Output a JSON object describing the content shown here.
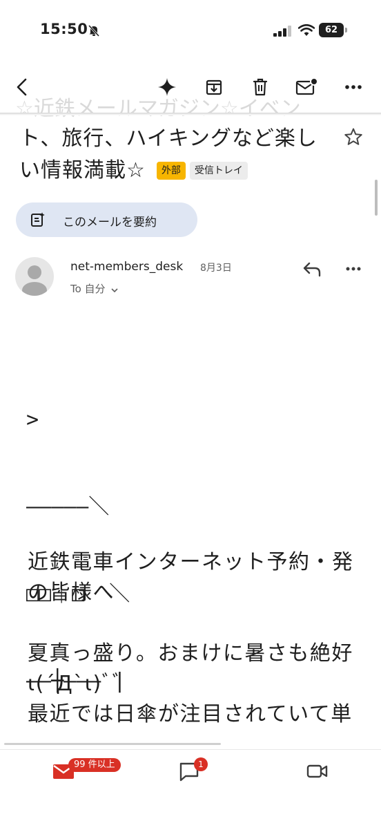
{
  "status_bar": {
    "time": "15:50",
    "battery": "62"
  },
  "toolbar": {
    "back_icon": "chevron-left-icon",
    "gemini_icon": "sparkle-icon",
    "archive_icon": "archive-icon",
    "delete_icon": "trash-icon",
    "unread_icon": "mark-unread-icon",
    "more_icon": "more-horizontal-icon"
  },
  "subject": {
    "line1_partial": "☆近鉄メールマガジン☆イベン",
    "line2": "ト、旅行、ハイキングなど楽し",
    "line3": "い情報満載☆",
    "badge_external": "外部",
    "badge_inbox": "受信トレイ"
  },
  "summary_button": {
    "label": "このメールを要約"
  },
  "message_header": {
    "sender": "net-members_desk",
    "date": "8月3日",
    "to": "To 自分"
  },
  "body": {
    "ascii_art": [
      ">",
      "―――――＼",
      "□□｜□  ＼",
      "――┼――― |",
      "――◎◎――-┘ ―――――――――――"
    ],
    "paragraph1_line1": "近鉄電車インターネット予約・発",
    "paragraph1_line2": "の皆様へ",
    "paragraph2_line1": "夏真っ盛り。おまけに暑さも絶好",
    "paragraph2_line2": "ι(´Д`ι)ﾞﾞ",
    "paragraph2_line3": "最近では日傘が注目されていて単"
  },
  "bottom_nav": {
    "mail_badge": "99 件以上",
    "chat_badge": "1",
    "meet_icon": "video-camera-icon"
  },
  "colors": {
    "badge_external_bg": "#f7b500",
    "summary_bg": "#dfe6f3",
    "mail_red": "#d93025"
  }
}
